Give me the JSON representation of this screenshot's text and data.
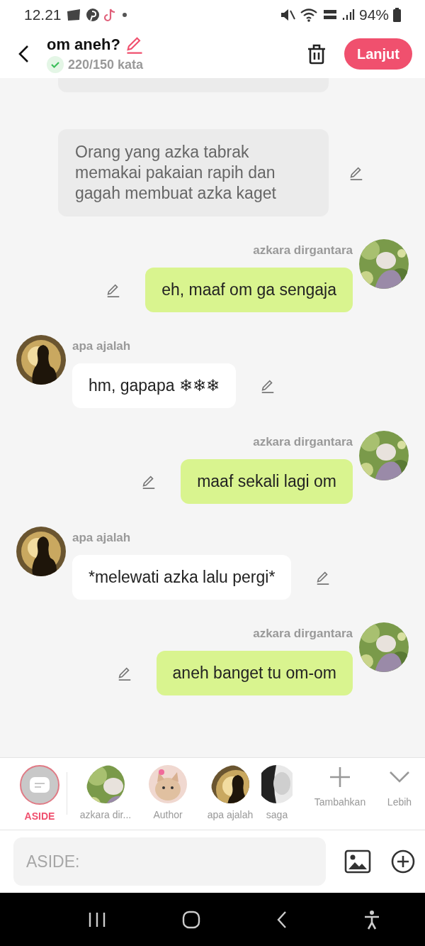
{
  "status_bar": {
    "time": "12.21",
    "battery": "94%"
  },
  "header": {
    "title": "om aneh?",
    "word_count": "220/150 kata",
    "next_button": "Lanjut"
  },
  "messages": [
    {
      "kind": "narration_cut"
    },
    {
      "kind": "narration",
      "text": "Orang yang azka tabrak memakai pakaian rapih dan gagah membuat azka kaget"
    },
    {
      "kind": "right",
      "name": "azkara dirgantara",
      "text": "eh, maaf om ga sengaja"
    },
    {
      "kind": "left",
      "name": "apa ajalah",
      "text": "hm, gapapa ❄❄❄"
    },
    {
      "kind": "right",
      "name": "azkara dirgantara",
      "text": "maaf sekali lagi om"
    },
    {
      "kind": "left",
      "name": "apa ajalah",
      "text": "*melewati azka lalu pergi*"
    },
    {
      "kind": "right",
      "name": "azkara dirgantara",
      "text": "aneh banget tu om-om"
    }
  ],
  "characters": [
    {
      "kind": "aside",
      "label": "ASIDE",
      "selected": true
    },
    {
      "kind": "garden",
      "label": "azkara dir...",
      "selected": false
    },
    {
      "kind": "cat",
      "label": "Author",
      "selected": false
    },
    {
      "kind": "silhouette",
      "label": "apa ajalah",
      "selected": false
    },
    {
      "kind": "mono",
      "label": "saga",
      "selected": false
    }
  ],
  "character_actions": [
    {
      "kind": "add",
      "label": "Tambahkan"
    },
    {
      "kind": "more",
      "label": "Lebih"
    }
  ],
  "composer": {
    "placeholder": "ASIDE:"
  }
}
